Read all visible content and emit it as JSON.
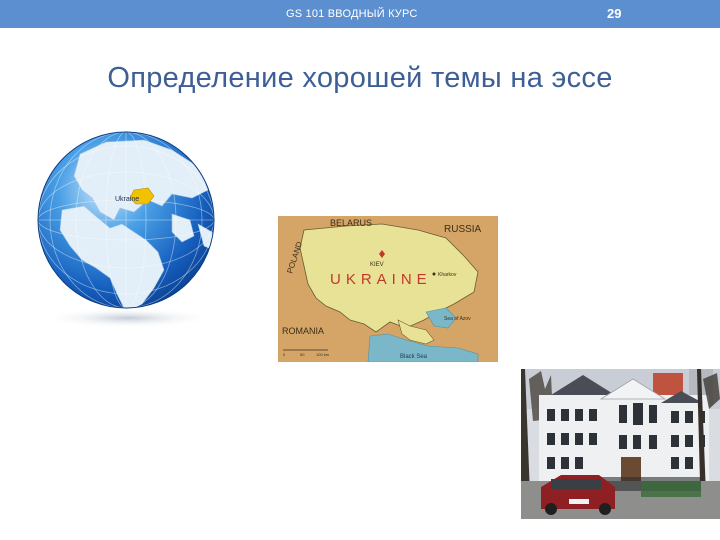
{
  "header": {
    "course_label": "GS 101 ВВОДНЫЙ КУРС",
    "page_number": "29",
    "bar_color": "#5b8fd0"
  },
  "slide": {
    "title": "Определение хорошей темы на эссе",
    "title_color": "#3d5f96"
  },
  "globe": {
    "label": "Ukraine"
  },
  "map": {
    "labels": {
      "belarus": "BELARUS",
      "russia": "RUSSIA",
      "poland": "POLAND",
      "ukraine": "UKRAINE",
      "romania": "ROMANIA",
      "kiev": "KIEV",
      "kharkov": "Kharkov",
      "sea_of_azov": "Sea of Azov",
      "black_sea": "Black Sea",
      "scale_0": "0",
      "scale_50": "50",
      "scale_100": "100 km"
    }
  }
}
